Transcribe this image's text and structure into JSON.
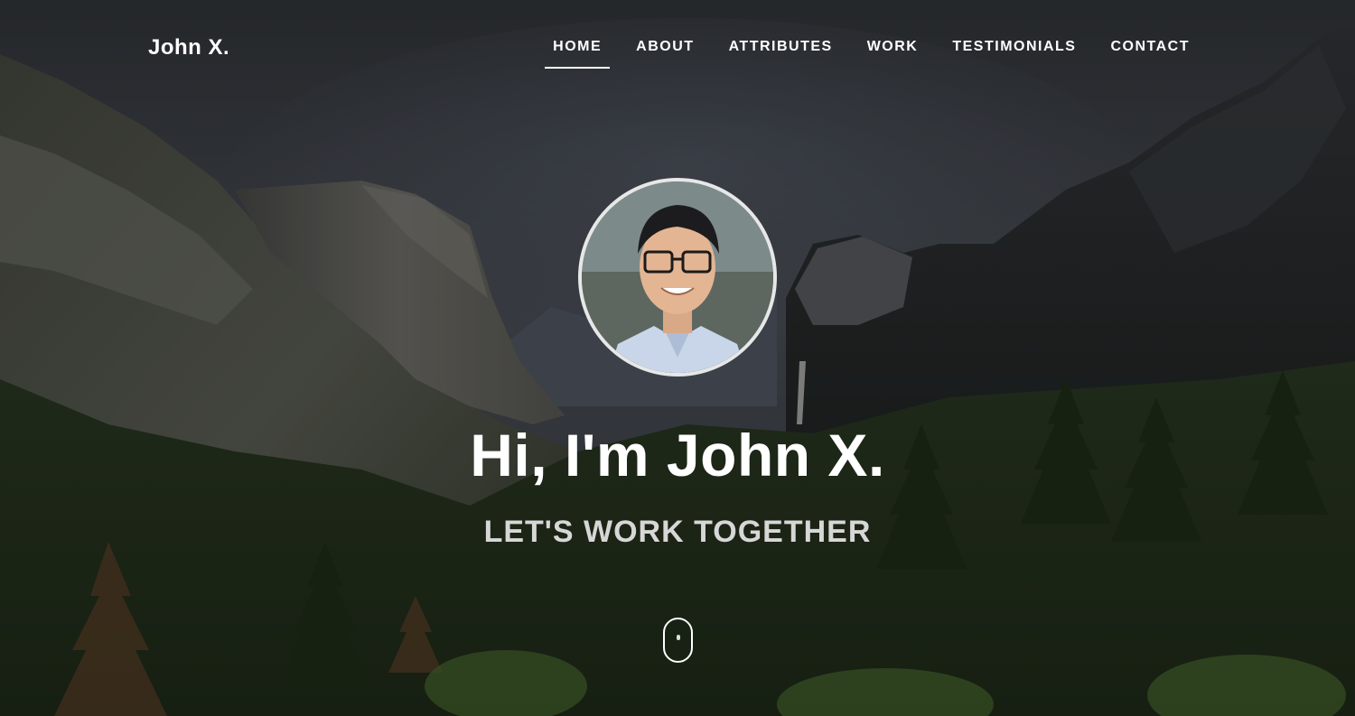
{
  "brand": "John X.",
  "nav": {
    "items": [
      {
        "label": "HOME",
        "active": true
      },
      {
        "label": "ABOUT",
        "active": false
      },
      {
        "label": "ATTRIBUTES",
        "active": false
      },
      {
        "label": "WORK",
        "active": false
      },
      {
        "label": "TESTIMONIALS",
        "active": false
      },
      {
        "label": "CONTACT",
        "active": false
      }
    ]
  },
  "hero": {
    "headline": "Hi, I'm John X.",
    "subheadline": "LET'S WORK TOGETHER"
  },
  "colors": {
    "text": "#ffffff",
    "subtext": "#d7d7d7",
    "avatar_border": "#e7e7e7"
  },
  "icons": {
    "scroll": "mouse-scroll-icon"
  }
}
